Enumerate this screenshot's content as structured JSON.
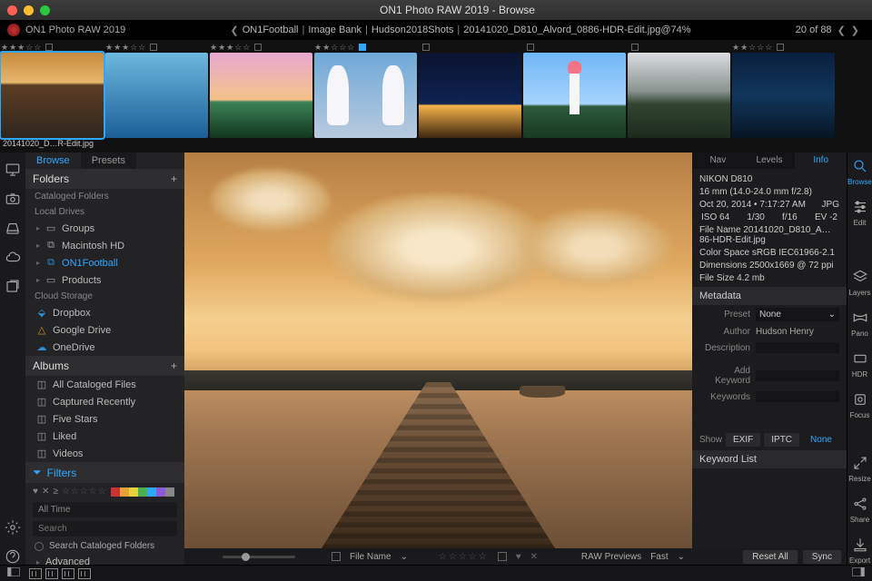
{
  "window": {
    "title": "ON1 Photo RAW 2019 - Browse",
    "app_name": "ON1 Photo RAW 2019"
  },
  "breadcrumb": {
    "segments": [
      "ON1Football",
      "Image Bank",
      "Hudson2018Shots",
      "20141020_D810_Alvord_0886-HDR-Edit.jpg@74%"
    ]
  },
  "counter": {
    "text": "20 of 88"
  },
  "thumbs": [
    {
      "rating": "★★★☆☆",
      "tagged": false,
      "caption": "20141020_D…R-Edit.jpg",
      "selected": true
    },
    {
      "rating": "★★★☆☆",
      "tagged": false
    },
    {
      "rating": "★★★☆☆",
      "tagged": false
    },
    {
      "rating": "★★☆☆☆",
      "tagged": true
    },
    {
      "rating": "",
      "tagged": false
    },
    {
      "rating": "",
      "tagged": false
    },
    {
      "rating": "",
      "tagged": false
    },
    {
      "rating": "★★☆☆☆",
      "tagged": false
    }
  ],
  "left_tabs": {
    "browse": "Browse",
    "presets": "Presets"
  },
  "folders": {
    "header": "Folders",
    "cataloged": "Cataloged Folders",
    "local": "Local Drives",
    "items": [
      {
        "icon": "folder",
        "label": "Groups"
      },
      {
        "icon": "drive",
        "label": "Macintosh HD"
      },
      {
        "icon": "drive",
        "label": "ON1Football",
        "selected": true
      },
      {
        "icon": "folder",
        "label": "Products"
      }
    ],
    "cloud": "Cloud Storage",
    "cloud_items": [
      {
        "icon": "dropbox",
        "label": "Dropbox",
        "color": "#2ea8ff"
      },
      {
        "icon": "gdrive",
        "label": "Google Drive",
        "color": "#f4b400"
      },
      {
        "icon": "onedrive",
        "label": "OneDrive",
        "color": "#2ea8ff"
      }
    ]
  },
  "albums": {
    "header": "Albums",
    "items": [
      "All Cataloged Files",
      "Captured Recently",
      "Five Stars",
      "Liked",
      "Videos"
    ]
  },
  "filters": {
    "header": "Filters",
    "stars": "☆☆☆☆☆",
    "swatches": [
      "#c33",
      "#e7a23a",
      "#e7d23a",
      "#4caf50",
      "#2ea8ff",
      "#8e5bd8",
      "#888"
    ],
    "time": "All Time",
    "search_ph": "Search",
    "cataloged": "Search Cataloged Folders",
    "advanced": "Advanced"
  },
  "right_tabs": {
    "nav": "Nav",
    "levels": "Levels",
    "info": "Info"
  },
  "info": {
    "camera": "NIKON D810",
    "lens": "16 mm (14.0-24.0 mm f/2.8)",
    "datetime": "Oct 20, 2014 • 7:17:27 AM",
    "format": "JPG",
    "metrics": {
      "iso": "ISO 64",
      "shutter": "1/30",
      "aperture": "f/16",
      "ev": "EV -2"
    },
    "filename_lbl": "File Name",
    "filename": "20141020_D810_A…86-HDR-Edit.jpg",
    "colorspace_lbl": "Color Space",
    "colorspace": "sRGB IEC61966-2.1",
    "dimensions_lbl": "Dimensions",
    "dimensions": "2500x1669 @ 72 ppi",
    "filesize_lbl": "File Size",
    "filesize": "4.2 mb"
  },
  "metadata": {
    "header": "Metadata",
    "preset_lbl": "Preset",
    "preset_val": "None",
    "author_lbl": "Author",
    "author_val": "Hudson Henry",
    "desc_lbl": "Description",
    "addkw_lbl": "Add Keyword",
    "kw_lbl": "Keywords",
    "show": "Show",
    "exif": "EXIF",
    "iptc": "IPTC",
    "none": "None",
    "kwlist": "Keyword List"
  },
  "right_rail": {
    "browse": "Browse",
    "edit": "Edit",
    "layers": "Layers",
    "pano": "Pano",
    "hdr": "HDR",
    "focus": "Focus",
    "resize": "Resize",
    "share": "Share",
    "export": "Export"
  },
  "center_bottom": {
    "filename": "File Name",
    "stars": "☆☆☆☆☆",
    "raw_lbl": "RAW Previews",
    "raw_val": "Fast"
  },
  "right_bottom": {
    "reset": "Reset All",
    "sync": "Sync"
  }
}
